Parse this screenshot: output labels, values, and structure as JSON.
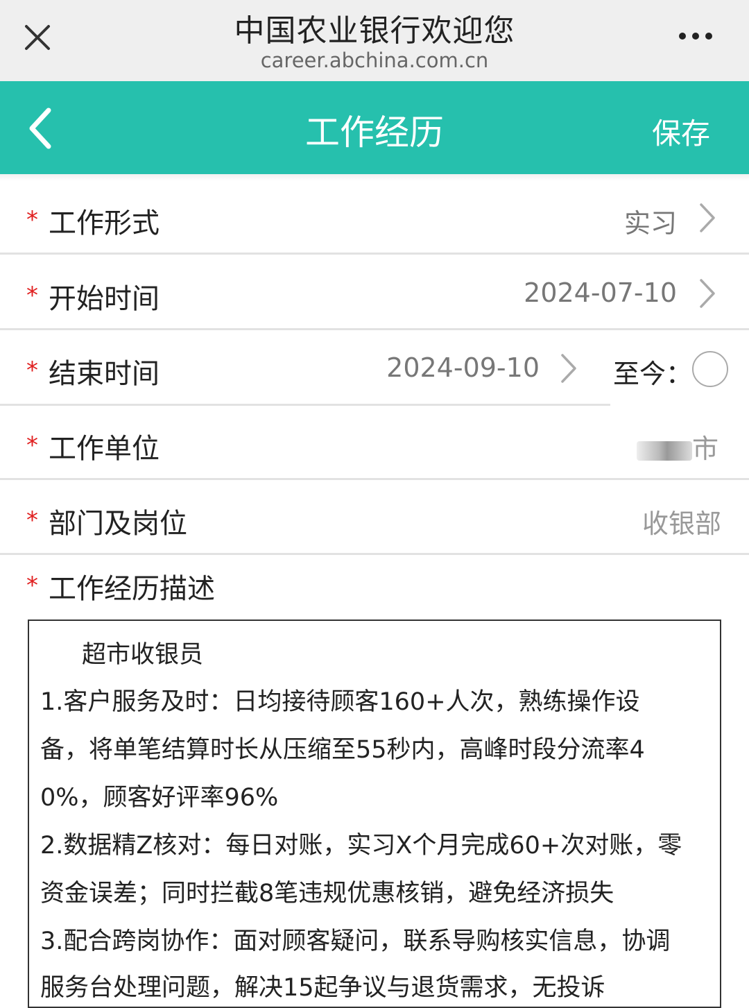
{
  "browser": {
    "title": "中国农业银行欢迎您",
    "url": "career.abchina.com.cn",
    "close_icon": "close-icon",
    "more_icon": "more-dots-icon"
  },
  "header": {
    "title": "工作经历",
    "save_label": "保存",
    "back_icon": "chevron-left-icon",
    "color": "#26c0ad"
  },
  "form": {
    "required_mark": "*",
    "work_type": {
      "label": "工作形式",
      "value": "实习"
    },
    "start_time": {
      "label": "开始时间",
      "value": "2024-07-10"
    },
    "end_time": {
      "label": "结束时间",
      "value": "2024-09-10",
      "to_now_label": "至今："
    },
    "employer": {
      "label": "工作单位",
      "value": "市"
    },
    "department": {
      "label": "部门及岗位",
      "value": "收银部"
    },
    "description": {
      "label": "工作经历描述",
      "lines": [
        "超市收银员",
        "1.客户服务及时：日均接待顾客160+人次，熟练操作设",
        "备，将单笔结算时长从压缩至55秒内，高峰时段分流率4",
        "0%，顾客好评率96%",
        "2.数据精Z核对：每日对账，实习X个月完成60+次对账，零",
        "资金误差；同时拦截8笔违规优惠核销，避免经济损失",
        "3.配合跨岗协作：面对顾客疑问，联系导购核实信息，协调",
        "服务台处理问题，解决15起争议与退货需求，无投诉"
      ]
    }
  }
}
